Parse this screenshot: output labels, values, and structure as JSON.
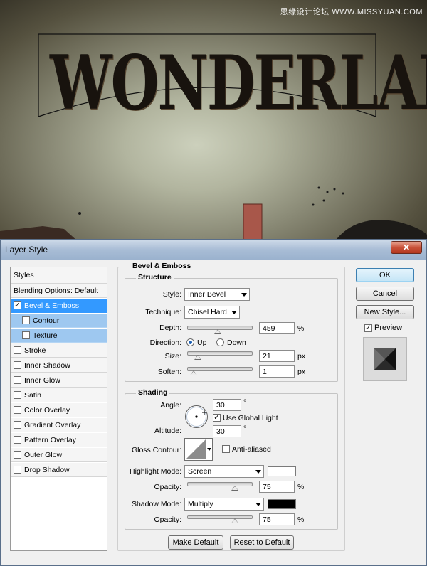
{
  "artwork": {
    "title_text": "WONDERLAND",
    "watermark": "思缘设计论坛 WWW.MISSYUAN.COM"
  },
  "dialog": {
    "title": "Layer Style",
    "close_glyph": "✕"
  },
  "styles_panel": {
    "header": "Styles",
    "blending_options": "Blending Options: Default",
    "check_glyph": "✓",
    "items": [
      {
        "label": "Bevel & Emboss",
        "checked": true
      },
      {
        "label": "Contour",
        "checked": false
      },
      {
        "label": "Texture",
        "checked": false
      },
      {
        "label": "Stroke",
        "checked": false
      },
      {
        "label": "Inner Shadow",
        "checked": false
      },
      {
        "label": "Inner Glow",
        "checked": false
      },
      {
        "label": "Satin",
        "checked": false
      },
      {
        "label": "Color Overlay",
        "checked": false
      },
      {
        "label": "Gradient Overlay",
        "checked": false
      },
      {
        "label": "Pattern Overlay",
        "checked": false
      },
      {
        "label": "Outer Glow",
        "checked": false
      },
      {
        "label": "Drop Shadow",
        "checked": false
      }
    ]
  },
  "bevel": {
    "section_title": "Bevel & Emboss",
    "structure_title": "Structure",
    "style_label": "Style:",
    "style_value": "Inner Bevel",
    "technique_label": "Technique:",
    "technique_value": "Chisel Hard",
    "depth_label": "Depth:",
    "depth_value": "459",
    "depth_unit": "%",
    "direction_label": "Direction:",
    "direction_up": "Up",
    "direction_down": "Down",
    "direction_selected": "Up",
    "size_label": "Size:",
    "size_value": "21",
    "size_unit": "px",
    "soften_label": "Soften:",
    "soften_value": "1",
    "soften_unit": "px"
  },
  "shading": {
    "title": "Shading",
    "angle_label": "Angle:",
    "angle_value": "30",
    "degree": "°",
    "use_global_light_label": "Use Global Light",
    "use_global_light": true,
    "altitude_label": "Altitude:",
    "altitude_value": "30",
    "gloss_contour_label": "Gloss Contour:",
    "anti_aliased_label": "Anti-aliased",
    "anti_aliased": false,
    "highlight_mode_label": "Highlight Mode:",
    "highlight_mode_value": "Screen",
    "highlight_color": "#ffffff",
    "highlight_opacity_label": "Opacity:",
    "highlight_opacity_value": "75",
    "percent": "%",
    "shadow_mode_label": "Shadow Mode:",
    "shadow_mode_value": "Multiply",
    "shadow_color": "#000000",
    "shadow_opacity_label": "Opacity:",
    "shadow_opacity_value": "75"
  },
  "bottom_buttons": {
    "make_default": "Make Default",
    "reset_to_default": "Reset to Default"
  },
  "right_panel": {
    "ok": "OK",
    "cancel": "Cancel",
    "new_style": "New Style...",
    "preview_label": "Preview",
    "preview_checked": true
  },
  "slider_levels": {
    "depth": 0.46,
    "size": 0.13,
    "soften": 0.06,
    "highlight_opacity": 0.75,
    "shadow_opacity": 0.75
  },
  "colors": {
    "selection_blue": "#3399ff",
    "sub_selection": "#9ec8f0",
    "titlebar": "#a9bdd6",
    "close_button": "#c9523a"
  }
}
